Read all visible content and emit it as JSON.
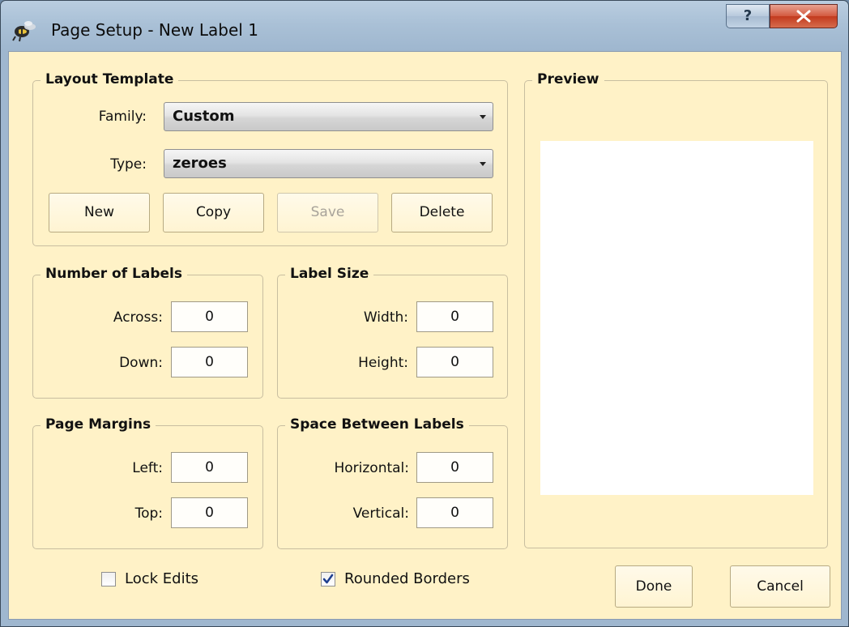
{
  "window": {
    "title": "Page Setup - New Label 1",
    "help_label": "?",
    "close_label": "X"
  },
  "layout_template": {
    "title": "Layout Template",
    "family_label": "Family:",
    "family_value": "Custom",
    "type_label": "Type:",
    "type_value": "zeroes",
    "buttons": {
      "new": "New",
      "copy": "Copy",
      "save": "Save",
      "delete": "Delete"
    }
  },
  "number_of_labels": {
    "title": "Number of Labels",
    "across_label": "Across:",
    "across_value": "0",
    "down_label": "Down:",
    "down_value": "0"
  },
  "label_size": {
    "title": "Label Size",
    "width_label": "Width:",
    "width_value": "0",
    "height_label": "Height:",
    "height_value": "0"
  },
  "page_margins": {
    "title": "Page Margins",
    "left_label": "Left:",
    "left_value": "0",
    "top_label": "Top:",
    "top_value": "0"
  },
  "space_between": {
    "title": "Space Between Labels",
    "horizontal_label": "Horizontal:",
    "horizontal_value": "0",
    "vertical_label": "Vertical:",
    "vertical_value": "0"
  },
  "preview": {
    "title": "Preview"
  },
  "options": {
    "lock_edits": "Lock Edits",
    "lock_edits_checked": false,
    "rounded_borders": "Rounded Borders",
    "rounded_borders_checked": true
  },
  "footer": {
    "done": "Done",
    "cancel": "Cancel"
  },
  "colors": {
    "dialog_bg": "#fff2c7",
    "title_bar": "#a9c0d6",
    "close_button": "#c94b2e"
  }
}
